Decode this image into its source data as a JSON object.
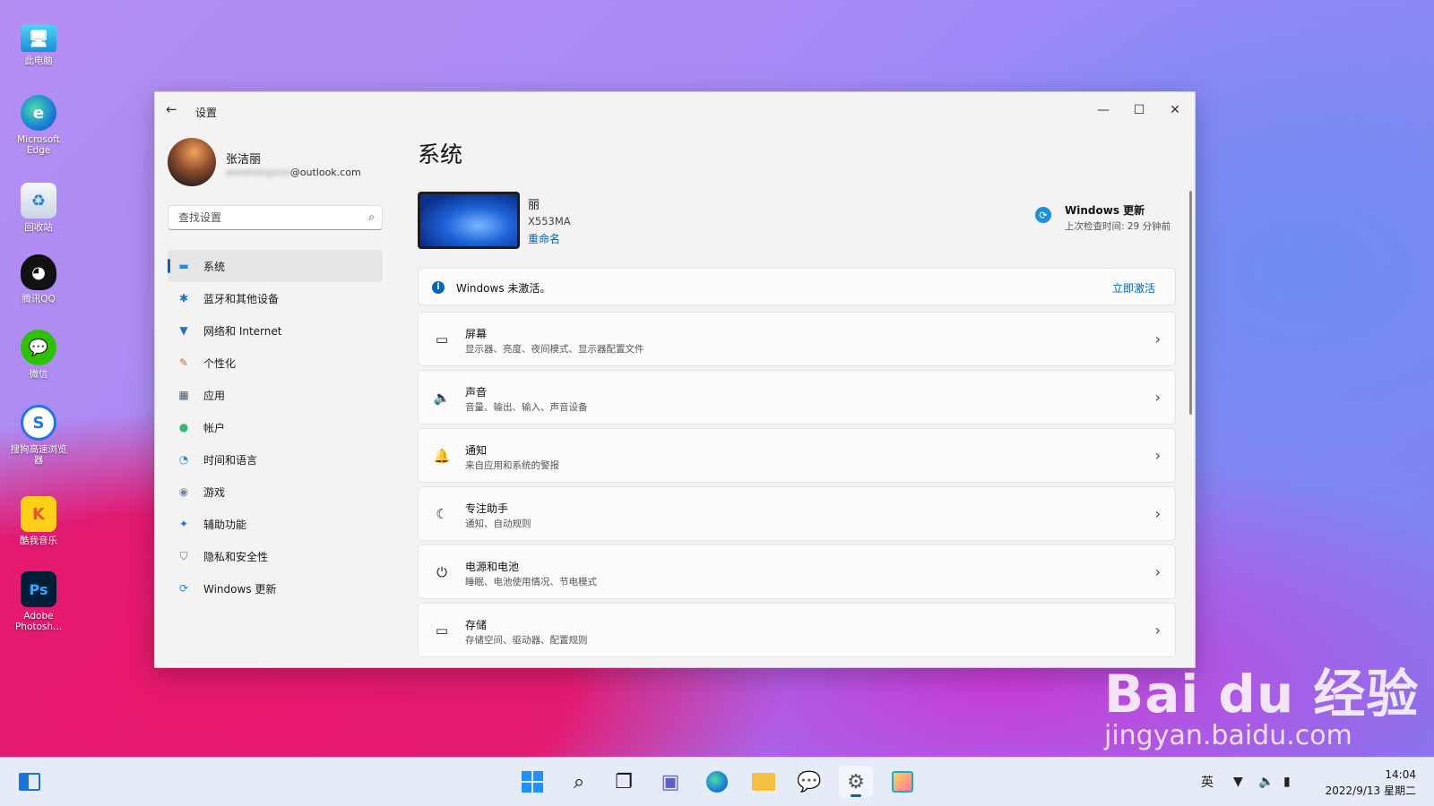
{
  "desktop": {
    "icons": [
      {
        "label": "此电脑",
        "icon": "computer-icon"
      },
      {
        "label": "Microsoft Edge",
        "icon": "edge-icon"
      },
      {
        "label": "回收站",
        "icon": "recycle-bin-icon"
      },
      {
        "label": "腾讯QQ",
        "icon": "qq-icon"
      },
      {
        "label": "微信",
        "icon": "wechat-icon"
      },
      {
        "label": "搜狗高速浏览器",
        "icon": "sogou-browser-icon"
      },
      {
        "label": "酷我音乐",
        "icon": "kuwo-music-icon"
      },
      {
        "label": "Adobe Photosh...",
        "icon": "photoshop-icon"
      }
    ]
  },
  "window": {
    "title": "设置",
    "user": {
      "name": "张洁丽",
      "email_hidden": "weishengxxx",
      "email_domain": "@outlook.com"
    },
    "search": {
      "placeholder": "查找设置"
    },
    "nav": [
      {
        "label": "系统",
        "icon": "monitor-icon",
        "active": true
      },
      {
        "label": "蓝牙和其他设备",
        "icon": "bluetooth-icon"
      },
      {
        "label": "网络和 Internet",
        "icon": "wifi-icon"
      },
      {
        "label": "个性化",
        "icon": "brush-icon"
      },
      {
        "label": "应用",
        "icon": "apps-icon"
      },
      {
        "label": "帐户",
        "icon": "person-icon"
      },
      {
        "label": "时间和语言",
        "icon": "globe-clock-icon"
      },
      {
        "label": "游戏",
        "icon": "gamepad-icon"
      },
      {
        "label": "辅助功能",
        "icon": "accessibility-icon"
      },
      {
        "label": "隐私和安全性",
        "icon": "shield-icon"
      },
      {
        "label": "Windows 更新",
        "icon": "update-icon"
      }
    ],
    "page_title": "系统",
    "device": {
      "name": "丽",
      "model": "X553MA",
      "rename": "重命名"
    },
    "update": {
      "title": "Windows 更新",
      "status": "上次检查时间: 29 分钟前"
    },
    "activation": {
      "text": "Windows 未激活。",
      "action": "立即激活"
    },
    "cards": [
      {
        "title": "屏幕",
        "subtitle": "显示器、亮度、夜间模式、显示器配置文件",
        "icon": "display-icon"
      },
      {
        "title": "声音",
        "subtitle": "音量、输出、输入、声音设备",
        "icon": "speaker-icon"
      },
      {
        "title": "通知",
        "subtitle": "来自应用和系统的警报",
        "icon": "bell-icon"
      },
      {
        "title": "专注助手",
        "subtitle": "通知、自动规则",
        "icon": "moon-icon"
      },
      {
        "title": "电源和电池",
        "subtitle": "睡眠、电池使用情况、节电模式",
        "icon": "power-icon"
      },
      {
        "title": "存储",
        "subtitle": "存储空间、驱动器、配置规则",
        "icon": "storage-icon"
      }
    ]
  },
  "watermark": {
    "line1": "Bai du 经验",
    "line2": "jingyan.baidu.com"
  },
  "taskbar": {
    "ime": "英",
    "time": "14:04",
    "date": "2022/9/13 星期二"
  }
}
